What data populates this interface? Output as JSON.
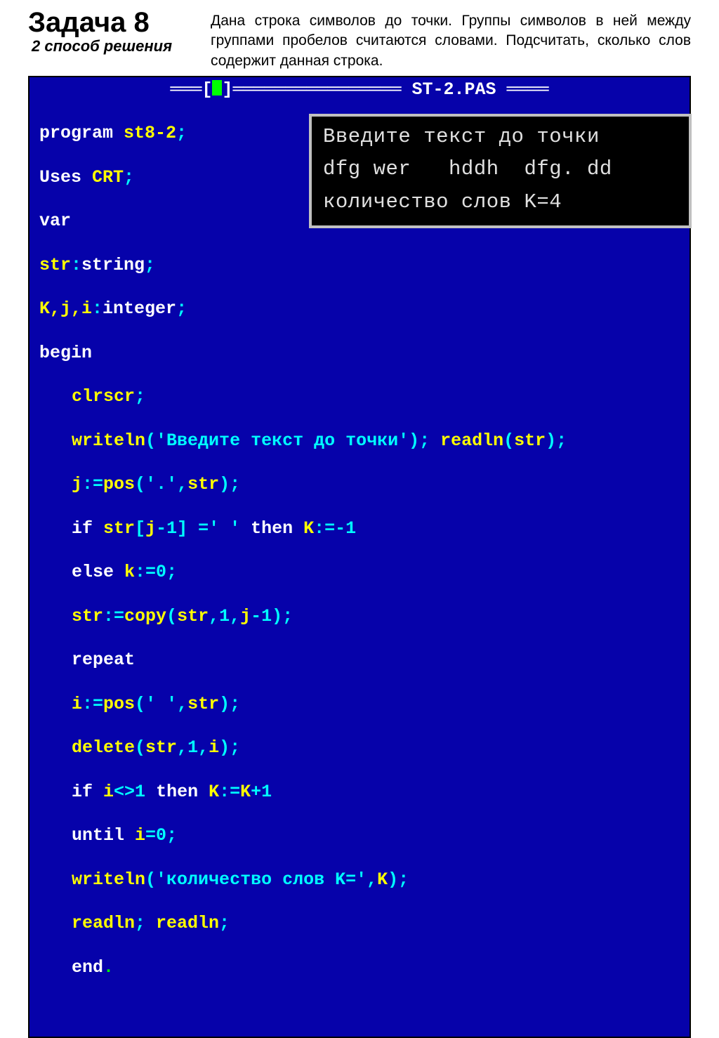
{
  "header": {
    "title": "Задача 8",
    "subtitle": "2 способ решения",
    "description": "Дана строка символов до точки. Группы символов в ней между группами пробелов считаются словами. Подсчитать, сколько слов содержит данная строка."
  },
  "ide": {
    "filename": "ST-2.PAS"
  },
  "code": {
    "l1_kw": "program",
    "l1_id": " st8-2",
    "l1_p": ";",
    "l2_kw": "Uses",
    "l2_id": " CRT",
    "l2_p": ";",
    "l3_kw": "var",
    "l4_id": "str",
    "l4_p1": ":",
    "l4_kw": "string",
    "l4_p2": ";",
    "l5_id": "K,j,i",
    "l5_p1": ":",
    "l5_kw": "integer",
    "l5_p2": ";",
    "l6_kw": "begin",
    "l7_id": "clrscr",
    "l7_p": ";",
    "l8_id1": "writeln",
    "l8_p1": "(",
    "l8_str": "'Введите текст до точки'",
    "l8_p2": "); ",
    "l8_id2": "readln",
    "l8_p3": "(",
    "l8_id3": "str",
    "l8_p4": ");",
    "l9_id": "j",
    "l9_p1": ":=",
    "l9_id2": "pos",
    "l9_p2": "(",
    "l9_str": "'.'",
    "l9_p3": ",",
    "l9_id3": "str",
    "l9_p4": ");",
    "l10_kw1": "if ",
    "l10_id": "str",
    "l10_p1": "[",
    "l10_id2": "j",
    "l10_p2": "-",
    "l10_num": "1",
    "l10_p3": "] =",
    "l10_str": "' '",
    "l10_kw2": " then ",
    "l10_id3": "K",
    "l10_p4": ":=-",
    "l10_num2": "1",
    "l11_kw": "else ",
    "l11_id": "k",
    "l11_p1": ":=",
    "l11_num": "0",
    "l11_p2": ";",
    "l12_id": "str",
    "l12_p1": ":=",
    "l12_id2": "copy",
    "l12_p2": "(",
    "l12_id3": "str",
    "l12_p3": ",",
    "l12_num1": "1",
    "l12_p4": ",",
    "l12_id4": "j",
    "l12_p5": "-",
    "l12_num2": "1",
    "l12_p6": ");",
    "l13_kw": "repeat",
    "l14_id": "i",
    "l14_p1": ":=",
    "l14_id2": "pos",
    "l14_p2": "(",
    "l14_str": "' '",
    "l14_p3": ",",
    "l14_id3": "str",
    "l14_p4": ");",
    "l15_id": "delete",
    "l15_p1": "(",
    "l15_id2": "str",
    "l15_p2": ",",
    "l15_num1": "1",
    "l15_p3": ",",
    "l15_id3": "i",
    "l15_p4": ");",
    "l16_kw1": "if ",
    "l16_id": "i",
    "l16_p1": "<>",
    "l16_num": "1",
    "l16_kw2": " then ",
    "l16_id2": "K",
    "l16_p2": ":=",
    "l16_id3": "K",
    "l16_p3": "+",
    "l16_num2": "1",
    "l17_kw": "until ",
    "l17_id": "i",
    "l17_p1": "=",
    "l17_num": "0",
    "l17_p2": ";",
    "l18_id": "writeln",
    "l18_p1": "(",
    "l18_str": "'количество слов K='",
    "l18_p2": ",",
    "l18_id2": "K",
    "l18_p3": ");",
    "l19_id1": "readln",
    "l19_p1": "; ",
    "l19_id2": "readln",
    "l19_p2": ";",
    "l20_kw": "end",
    "l20_p": "."
  },
  "output": {
    "line1": "Введите текст до точки",
    "line2": "dfg wer   hddh  dfg. dd",
    "line3": "количество слов K=4"
  }
}
